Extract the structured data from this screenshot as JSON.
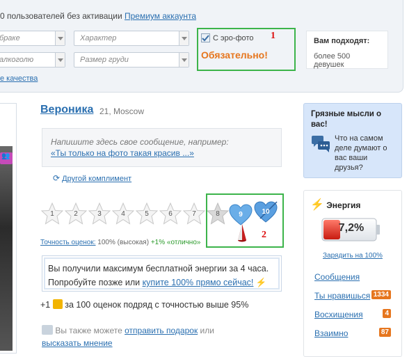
{
  "top": {
    "text": "0 пользователей без активации",
    "link": "Премиум аккаунта"
  },
  "filters": {
    "row1": [
      "браке",
      "Характер"
    ],
    "row2": [
      "алкоголю",
      "Размер груди"
    ]
  },
  "ero": {
    "checkbox_label": "С эро-фото",
    "required": "Обязательно!",
    "marker": "1"
  },
  "suitable": {
    "title": "Вам подходят:",
    "count": "более 500 девушек"
  },
  "bottom_link": "е качества",
  "profile": {
    "name": "Вероника",
    "age_city": "21, Moscow"
  },
  "message": {
    "placeholder": "Напишите здесь свое сообщение, например:",
    "example": "«Ты только на фото такая красив ...»"
  },
  "other_compliment": "Другой комплимент",
  "rating": {
    "stars": [
      "1",
      "2",
      "3",
      "4",
      "5",
      "6",
      "7",
      "8"
    ],
    "hearts": [
      "9",
      "10"
    ],
    "marker": "2",
    "accuracy_label": "Точность оценок:",
    "accuracy_value": "100% (высокая)",
    "accuracy_bonus": "+1% «отлично»"
  },
  "energy_message": {
    "line1": "Вы получили максимум бесплатной энергии за 4 часа.",
    "line2": "Попробуйте позже или",
    "link": "купите 100% прямо сейчас!"
  },
  "plus": {
    "prefix": "+1",
    "text": "за 100 оценок подряд с точностью выше 95%"
  },
  "gift": {
    "text1": "Вы также можете",
    "link1": "отправить подарок",
    "text2": "или",
    "link2": "высказать мнение"
  },
  "dirty": {
    "title": "Грязные мысли о вас!",
    "text": "Что на самом деле думают о вас ваши друзья?"
  },
  "energy": {
    "title": "Энергия",
    "percent": "7,2%",
    "level": 0.072,
    "charge": "Зарядить на 100%"
  },
  "right_list": [
    {
      "label": "Сообщения",
      "badge": ""
    },
    {
      "label": "Ты нравишься",
      "badge": "1334"
    },
    {
      "label": "Восхищения",
      "badge": "4"
    },
    {
      "label": "Взаимно",
      "badge": "87"
    }
  ],
  "colors": {
    "link": "#2a6fb0",
    "green_frame": "#3cb44a",
    "orange": "#e6761e",
    "red_marker": "#dd1111"
  }
}
